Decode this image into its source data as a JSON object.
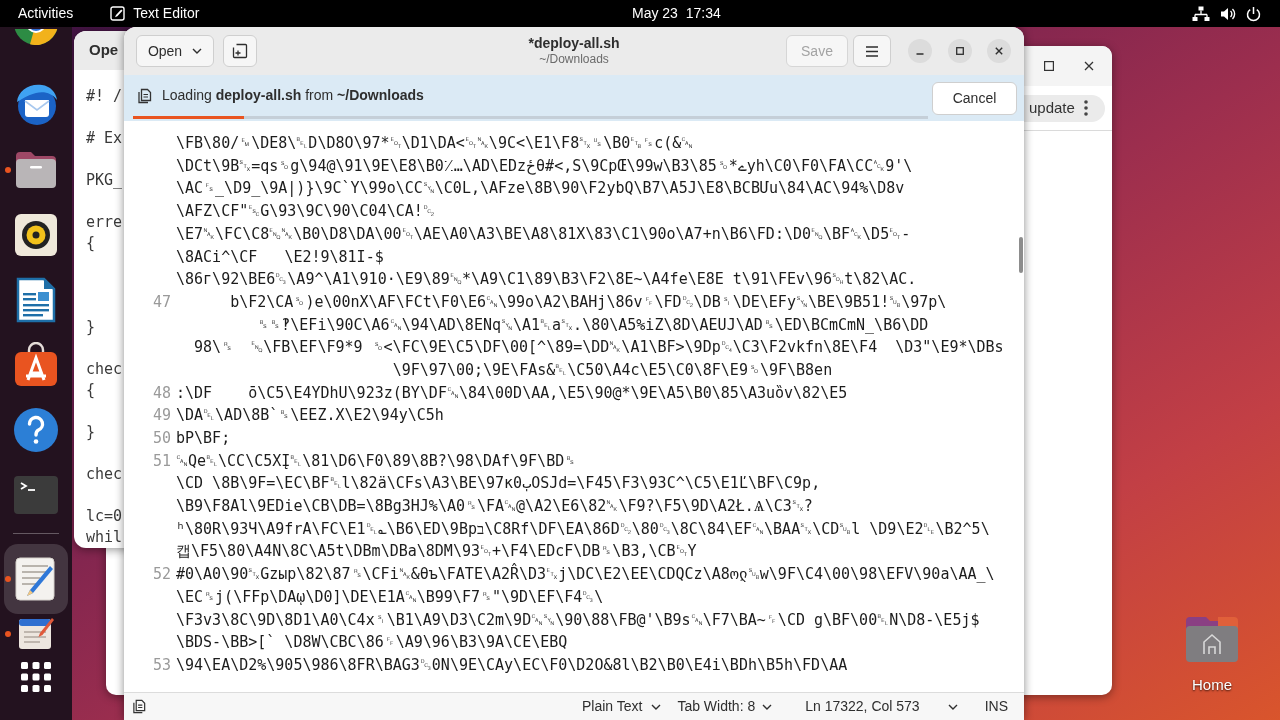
{
  "top_bar": {
    "activities": "Activities",
    "app_menu": "Text Editor",
    "clock": "May 23  17:34"
  },
  "dock": {
    "pinned": [
      {
        "kind": "browser",
        "running": false,
        "selected": false
      },
      {
        "kind": "mail",
        "running": false,
        "selected": false
      },
      {
        "kind": "files",
        "running": true,
        "selected": false
      },
      {
        "kind": "music",
        "running": false,
        "selected": false
      },
      {
        "kind": "writer",
        "running": false,
        "selected": false
      },
      {
        "kind": "store",
        "running": false,
        "selected": false
      },
      {
        "kind": "help",
        "running": false,
        "selected": false
      },
      {
        "kind": "terminal",
        "running": false,
        "selected": false
      }
    ],
    "running": [
      {
        "kind": "editor",
        "running": true,
        "selected": true
      },
      {
        "kind": "notebook",
        "running": true,
        "selected": false
      }
    ]
  },
  "desktop_icons": [
    {
      "kind": "home",
      "label": "Home"
    }
  ],
  "browser_window": {
    "toolbar_button": "update"
  },
  "behind_editor_window": {
    "title": "Ope",
    "lines": [
      "#! /",
      "# Ex",
      "PKG_",
      "erre",
      "{",
      "}",
      "chec",
      "{",
      "}",
      "chec",
      "lc=0",
      "whil"
    ]
  },
  "editor": {
    "header": {
      "open_button": "Open",
      "title": "*deploy-all.sh",
      "subtitle": "~/Downloads",
      "save_button": {
        "label": "Save",
        "disabled": true
      }
    },
    "infobar": {
      "message": "Loading **deploy-all.sh** from **~/Downloads**",
      "cancel_button": "Cancel",
      "progress": {
        "level": 0.14
      }
    },
    "lines": [
      {
        "rows": [
          "\\FB\\80/␙\\DE8\\␇D\\D8O\\97*␄\\D1\\DA<␄␕\\9C<\\E1\\F8␂␟\\B0␗␜c(&␘",
          "\\DCt\\9B␂=qs␎g\\94@\\91\\9E\\E8\\B0⁒…\\AD\\EDzځθ#<,S\\9CpŒ\\99w\\B3\\85␎*ےyh\\C0\\F0\\FA\\CC␆9'\\",
          "\\AC␜_\\D9_\\9A|)}\\9C`Y\\99o\\CC␖\\C0L,\\AFze\\8B\\90\\F2ybQ\\B7\\A5J\\E8\\BCBՄu\\84\\AC\\94%\\D8v",
          "\\AFZ\\CF\"␛G\\93\\9C\\90\\C04\\CA!␒",
          "\\E7␕\\FC\\C8␅␕\\B0\\D8\\DA\\00␄\\AE\\A0\\A3\\BE\\A8\\81X\\83\\C1\\90o\\A7+n\\B6\\FD:\\D0␅\\BF␆\\D5␄-",
          "\\8ACi^\\CF\t\\E2!9\\81I-$",
          "\\86г\\92\\BE6␓\\A9^\\A1\\910·\\E9\\89␅*\\A9\\C1\\89\\B3\\F2\\8E~\\A4fe\\E8E t\\91\\FEv\\96␁t\\82\\AC."
        ]
      },
      {
        "number": "47",
        "rows": [
          "\t  b\\F2\\CA␎)e\\00nX\\AF\\FCt\\F0\\E6␘\\99o\\A2\\BAHj\\86v␌\\FD␒\\DB␏\\DE\\EFy␖\\BE\\9B51!␚\\97p\\",
          "\t\t ␈␈‽\\EFi\\90C\\A6␘\\94\\AD\\8ENq␖\\A1␇a␂.\\80\\A5%iZ\\8D\\AEUJ\\AD␈\\ED\\BCmCmN_\\B6\\DD",
          "  98\\␞  ␅\\FB\\EF\\F9*9 ␎<\\FC\\9E\\C5\\DF\\00[^\\89=\\DD␕\\A1\\BF>\\9Dp␔\\C3\\F2vkfn\\8E\\F4  \\D3\"\\E9*\\DBs",
          "\t\t\t\t\t    \\9F\\97\\00;\\9E\\FAs&␇\\C50\\A4c\\E5\\C0\\8F\\E9␎\\9F\\B8en"
        ]
      },
      {
        "number": "48",
        "rows": [
          ":\\DF\tō\\C5\\E4YDhU\\923z(BY\\DF␘\\84\\00D\\AA,\\E5\\90@*\\9E\\A5\\B0\\85\\A3uȍv\\82\\E5"
        ]
      },
      {
        "number": "49",
        "rows": [
          "\\DA␡\\AD\\8B`␈\\EEZ.X\\E2\\94y\\C5h"
        ]
      },
      {
        "number": "50",
        "rows": [
          "bP\\BF;"
        ]
      },
      {
        "number": "51",
        "rows": [
          "␘Qe␇\\CC\\C5XĮ␇\\81\\D6\\F0\\89\\8B?\\98\\DAf\\9F\\BD␈",
          "\\CD \\8B\\9F=\\EC\\BF␇l\\82ä\\CFs\\A3\\BE\\97ĸ0ٻOSJd=\\F45\\F3\\93C^\\C5\\E1Ľ\\BF\\C9p,",
          "\\B9\\F8Al\\9EDie\\CB\\DB=\\8Bg3HJ%\\A0␞\\FA␘@\\A2\\E6\\82␕\\F9?\\F5\\9D\\A2Ł.Ѧ\\C3␂?",
          "ʰ\\80R\\93Ч\\A9frA\\FC\\E1␡؎\\B6\\ED\\9Bpב\\C8Rf\\DF\\EA\\86D␒\\80␓\\8C\\84\\EF␘\\BAA␂\\CD␚l \\D9\\E2␐\\B2^5\\",
          "캡\\F5\\80\\A4N\\8C\\A5t\\DBm\\DBa\\8DM\\93␄+\\F4\\EDcF\\DB␞\\B3,\\CB␄Y"
        ]
      },
      {
        "number": "52",
        "rows": [
          "#0\\A0\\90␂Gzыр\\82\\87␞\\CFi␕&θъ\\FATE\\A2R̂\\D3␃j\\DC\\E2\\EE\\CDQCz\\A8ოლ␚w\\9F\\C4\\00\\98\\EFV\\90a\\AA_\\",
          "\\EC␞j(\\FFp\\DAῳ\\D0]\\DE\\E1A␘\\B99\\F7␞\"\\9D\\EF\\F4␓\\",
          "\\F3v3\\8C\\9D\\8D1\\A0\\C4x␏\\B1\\A9\\D3\\C2m\\9D␘␖\\90\\88\\FB@'\\B9s␘\\F7\\BA~␌\\CD g\\BF\\00␇N\\D8-\\E5j$",
          "\\BDS-\\BB>[` \\D8W\\CBC\\86␌\\A9\\96\\B3\\9A\\CE\\EBQ"
        ]
      },
      {
        "number": "53",
        "rows": [
          "\\94\\EA\\D2%\\905\\986\\8FR\\BAG3␓0N\\9E\\CAy\\EC\\F0\\D2O&8l\\B2\\B0\\E4i\\BDh\\B5h\\FD\\AA"
        ]
      }
    ],
    "status_bar": {
      "language": "Plain Text",
      "tab_width": "Tab Width: 8",
      "position": "Ln 17322, Col 573",
      "mode": "INS"
    }
  }
}
